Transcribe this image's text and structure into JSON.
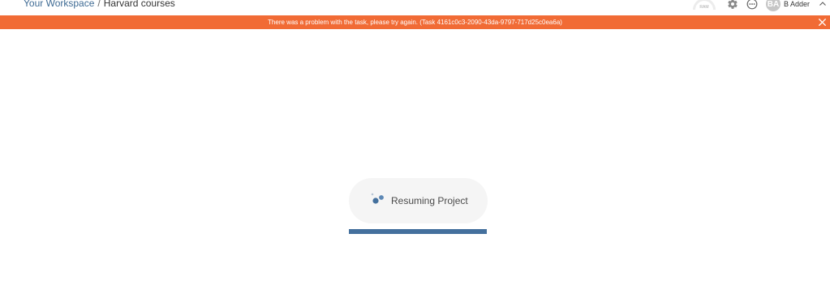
{
  "breadcrumb": {
    "workspace": "Your Workspace",
    "separator": "/",
    "project": "Harvard courses"
  },
  "header": {
    "ram_label": "RAM",
    "settings_icon": "gear-icon",
    "more_icon": "more-options-icon",
    "avatar_initials": "BA",
    "user_name": "B Adder",
    "collapse_icon": "chevron-up-icon"
  },
  "banner": {
    "message": "There was a problem with the task, please try again. (Task 4161c0c3-2090-43da-9797-717d25c0ea6a)",
    "close_icon": "close-icon"
  },
  "loader": {
    "label": "Resuming Project",
    "progress": 1.0
  },
  "colors": {
    "banner": "#f16b35",
    "accent": "#44709d",
    "link": "#3f6b94"
  }
}
